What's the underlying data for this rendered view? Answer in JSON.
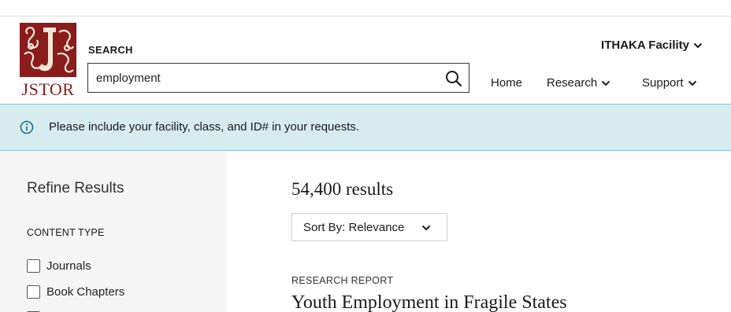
{
  "brand": {
    "name": "JSTOR",
    "color": "#8a1c1c"
  },
  "search": {
    "label": "SEARCH",
    "value": "employment",
    "button_icon": "search-icon"
  },
  "header": {
    "facility_menu": "ITHAKA Facility",
    "nav": [
      {
        "label": "Home",
        "has_dropdown": false
      },
      {
        "label": "Research",
        "has_dropdown": true
      },
      {
        "label": "Support",
        "has_dropdown": true
      }
    ]
  },
  "banner": {
    "icon": "info-icon",
    "text": "Please include your facility, class, and ID# in your requests.",
    "background": "#d6ecef"
  },
  "sidebar": {
    "title": "Refine Results",
    "section": "CONTENT TYPE",
    "options": [
      {
        "label": "Journals",
        "checked": false
      },
      {
        "label": "Book Chapters",
        "checked": false
      },
      {
        "label": "",
        "checked": false
      }
    ]
  },
  "results": {
    "count": "54,400 results",
    "sort_label": "Sort By: Relevance",
    "items": [
      {
        "type": "RESEARCH REPORT",
        "title": "Youth Employment in Fragile States"
      }
    ]
  }
}
